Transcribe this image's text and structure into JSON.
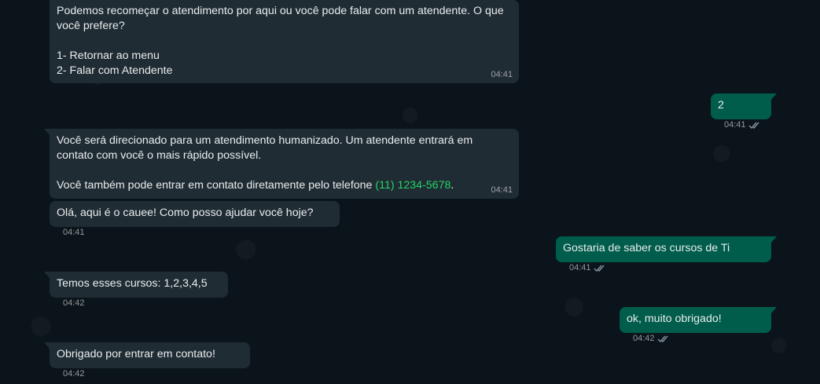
{
  "colors": {
    "background": "#0b141a",
    "incoming_bubble": "#202c33",
    "outgoing_bubble": "#005c4b",
    "meta_text": "#8696a0",
    "phone_link": "#25d366"
  },
  "messages": {
    "m1": {
      "direction": "incoming",
      "text": "Podemos recomeçar o atendimento por aqui ou você pode falar com um atendente. O que você prefere?\n\n1- Retornar ao menu\n2- Falar com Atendente",
      "time": "04:41"
    },
    "m2": {
      "direction": "outgoing",
      "text": "2",
      "time": "04:41",
      "status_icon": "double-check-icon"
    },
    "m3": {
      "direction": "incoming",
      "text": "Você será direcionado para um atendimento humanizado. Um atendente entrará em contato com você o mais rápido possível.\n\nVocê também pode entrar em contato diretamente pelo telefone ",
      "phone": "(11) 1234-5678",
      "text_after": ".",
      "time": "04:41"
    },
    "m4": {
      "direction": "incoming",
      "text": "Olá, aqui é o cauee! Como posso ajudar você hoje?",
      "time": "04:41"
    },
    "m5": {
      "direction": "outgoing",
      "text": "Gostaria de saber os cursos de Ti",
      "time": "04:41",
      "status_icon": "double-check-icon"
    },
    "m6": {
      "direction": "incoming",
      "text": "Temos esses cursos: 1,2,3,4,5",
      "time": "04:42"
    },
    "m7": {
      "direction": "outgoing",
      "text": "ok, muito obrigado!",
      "time": "04:42",
      "status_icon": "double-check-icon"
    },
    "m8": {
      "direction": "incoming",
      "text": "Obrigado por entrar em contato!",
      "time": "04:42"
    }
  }
}
